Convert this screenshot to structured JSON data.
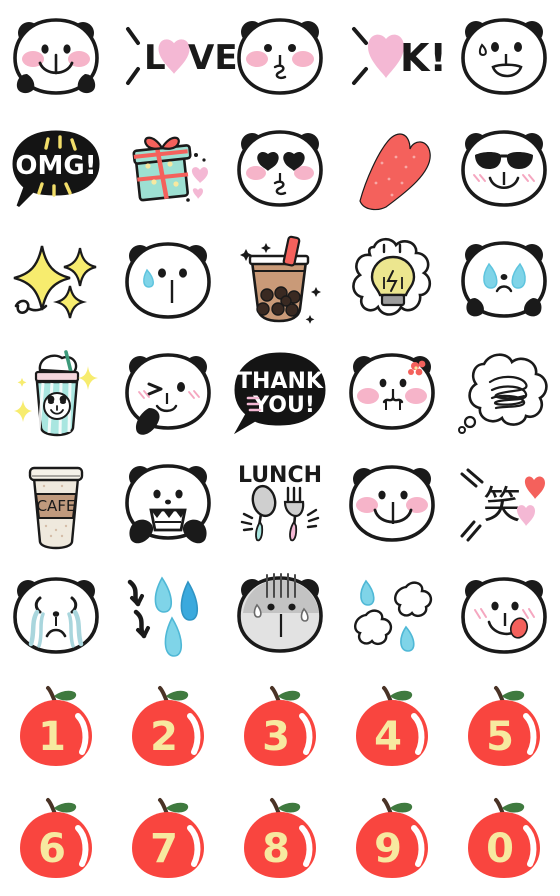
{
  "page": {
    "title": "Panda Emoji Sticker Sheet",
    "background_color": "#ffffff",
    "columns": 5,
    "rows": 8,
    "total_stickers": 40
  },
  "palette": {
    "outline": "#1a1a1a",
    "panda_white": "#ffffff",
    "cheek_pink": "#f5a7c0",
    "heart_pink": "#f4b8d4",
    "heart_red": "#f4615c",
    "apple_red": "#f9453f",
    "apple_number_yellow": "#f7e9a0",
    "apple_leaf_green": "#3f7a3f",
    "apple_stem_brown": "#4a3326",
    "sparkle_yellow": "#f7ec6e",
    "tear_blue": "#7fd4e8",
    "tear_blue_dark": "#3aa9dd",
    "boba_tan": "#c99a78",
    "boba_dark": "#3a2a22",
    "gift_mint": "#9de0d2",
    "gift_red": "#f4615c",
    "cafe_beige": "#efe9dd",
    "cafe_band": "#c09a7d",
    "frappe_mint": "#a9e6e0",
    "bulb_yellow": "#ece68f",
    "speech_black": "#141414",
    "omg_accent_yellow": "#f2de6a",
    "thankyou_accent_pink": "#f4b8d4"
  },
  "stickers": [
    {
      "row": 1,
      "col": 1,
      "id": "panda-smile-arms",
      "label": "Smiling panda with arms up",
      "text": "",
      "kind": "panda"
    },
    {
      "row": 1,
      "col": 2,
      "id": "love-text",
      "label": "LOVE text with heart O",
      "text": "LOVE",
      "kind": "text"
    },
    {
      "row": 1,
      "col": 3,
      "id": "panda-kiss",
      "label": "Panda blowing a kiss",
      "text": "",
      "kind": "panda"
    },
    {
      "row": 1,
      "col": 4,
      "id": "ok-text",
      "label": "OK! text with heart O",
      "text": "OK!",
      "kind": "text"
    },
    {
      "row": 1,
      "col": 5,
      "id": "panda-sweat-smile",
      "label": "Panda with sweat drop smiling",
      "text": "",
      "kind": "panda"
    },
    {
      "row": 2,
      "col": 1,
      "id": "omg-speech-bubble",
      "label": "OMG! speech bubble",
      "text": "OMG!",
      "kind": "bubble"
    },
    {
      "row": 2,
      "col": 2,
      "id": "gift-box",
      "label": "Mint gift box with hearts",
      "text": "",
      "kind": "object"
    },
    {
      "row": 2,
      "col": 3,
      "id": "panda-heart-eyes",
      "label": "Panda with heart eyes",
      "text": "",
      "kind": "panda"
    },
    {
      "row": 2,
      "col": 4,
      "id": "red-heart",
      "label": "Big red heart",
      "text": "",
      "kind": "object"
    },
    {
      "row": 2,
      "col": 5,
      "id": "panda-sunglasses",
      "label": "Panda wearing sunglasses",
      "text": "",
      "kind": "panda"
    },
    {
      "row": 3,
      "col": 1,
      "id": "sparkles",
      "label": "Yellow sparkles",
      "text": "",
      "kind": "object"
    },
    {
      "row": 3,
      "col": 2,
      "id": "panda-sweat",
      "label": "Panda with single sweat drop",
      "text": "",
      "kind": "panda"
    },
    {
      "row": 3,
      "col": 3,
      "id": "bubble-tea",
      "label": "Bubble tea drink",
      "text": "",
      "kind": "object"
    },
    {
      "row": 3,
      "col": 4,
      "id": "idea-lightbulb",
      "label": "Light bulb idea cloud",
      "text": "",
      "kind": "object"
    },
    {
      "row": 3,
      "col": 5,
      "id": "panda-crying",
      "label": "Panda crying with tears",
      "text": "",
      "kind": "panda"
    },
    {
      "row": 4,
      "col": 1,
      "id": "frappe-drink",
      "label": "Panda frappe cup with sparkles",
      "text": "",
      "kind": "object"
    },
    {
      "row": 4,
      "col": 2,
      "id": "panda-wink",
      "label": "Winking panda waving",
      "text": "",
      "kind": "panda"
    },
    {
      "row": 4,
      "col": 3,
      "id": "thankyou-bubble",
      "label": "THANK YOU! speech bubble",
      "text": "THANK YOU!",
      "kind": "bubble"
    },
    {
      "row": 4,
      "col": 4,
      "id": "panda-flower-pout",
      "label": "Panda with red flower pouting",
      "text": "",
      "kind": "panda"
    },
    {
      "row": 4,
      "col": 5,
      "id": "scribble-cloud",
      "label": "Scribble thought cloud",
      "text": "",
      "kind": "object"
    },
    {
      "row": 5,
      "col": 1,
      "id": "cafe-cup",
      "label": "CAFE takeaway coffee cup",
      "text": "CAFE",
      "kind": "object"
    },
    {
      "row": 5,
      "col": 2,
      "id": "panda-grin",
      "label": "Panda grinning with teeth",
      "text": "",
      "kind": "panda"
    },
    {
      "row": 5,
      "col": 3,
      "id": "lunch-cutlery",
      "label": "LUNCH with spoon and fork",
      "text": "LUNCH",
      "kind": "text"
    },
    {
      "row": 5,
      "col": 4,
      "id": "panda-big-smile",
      "label": "Panda with big smile",
      "text": "",
      "kind": "panda"
    },
    {
      "row": 5,
      "col": 5,
      "id": "warai-kanji",
      "label": "Kanji laugh with hearts",
      "text": "笑",
      "kind": "text"
    },
    {
      "row": 6,
      "col": 1,
      "id": "panda-sobbing",
      "label": "Panda sobbing streams of tears",
      "text": "",
      "kind": "panda"
    },
    {
      "row": 6,
      "col": 2,
      "id": "arrows-sweat-drops",
      "label": "Down arrows with sweat drops",
      "text": "",
      "kind": "object"
    },
    {
      "row": 6,
      "col": 3,
      "id": "panda-gloomy",
      "label": "Gloomy shaded panda with lines",
      "text": "",
      "kind": "panda"
    },
    {
      "row": 6,
      "col": 4,
      "id": "puff-clouds-drop",
      "label": "Puff clouds with water drops",
      "text": "",
      "kind": "object"
    },
    {
      "row": 6,
      "col": 5,
      "id": "panda-tongue",
      "label": "Panda sticking out tongue",
      "text": "",
      "kind": "panda"
    },
    {
      "row": 7,
      "col": 1,
      "id": "apple-1",
      "label": "Red apple number 1",
      "text": "1",
      "kind": "apple"
    },
    {
      "row": 7,
      "col": 2,
      "id": "apple-2",
      "label": "Red apple number 2",
      "text": "2",
      "kind": "apple"
    },
    {
      "row": 7,
      "col": 3,
      "id": "apple-3",
      "label": "Red apple number 3",
      "text": "3",
      "kind": "apple"
    },
    {
      "row": 7,
      "col": 4,
      "id": "apple-4",
      "label": "Red apple number 4",
      "text": "4",
      "kind": "apple"
    },
    {
      "row": 7,
      "col": 5,
      "id": "apple-5",
      "label": "Red apple number 5",
      "text": "5",
      "kind": "apple"
    },
    {
      "row": 8,
      "col": 1,
      "id": "apple-6",
      "label": "Red apple number 6",
      "text": "6",
      "kind": "apple"
    },
    {
      "row": 8,
      "col": 2,
      "id": "apple-7",
      "label": "Red apple number 7",
      "text": "7",
      "kind": "apple"
    },
    {
      "row": 8,
      "col": 3,
      "id": "apple-8",
      "label": "Red apple number 8",
      "text": "8",
      "kind": "apple"
    },
    {
      "row": 8,
      "col": 4,
      "id": "apple-9",
      "label": "Red apple number 9",
      "text": "9",
      "kind": "apple"
    },
    {
      "row": 8,
      "col": 5,
      "id": "apple-0",
      "label": "Red apple number 0",
      "text": "0",
      "kind": "apple"
    }
  ],
  "apple_numbers": [
    "1",
    "2",
    "3",
    "4",
    "5",
    "6",
    "7",
    "8",
    "9",
    "0"
  ],
  "text_stickers": {
    "love": "LOVE",
    "ok": "OK!",
    "omg": "OMG!",
    "thank_you_line1": "THANK",
    "thank_you_line2": "YOU!",
    "cafe": "CAFE",
    "lunch": "LUNCH",
    "warai": "笑"
  }
}
